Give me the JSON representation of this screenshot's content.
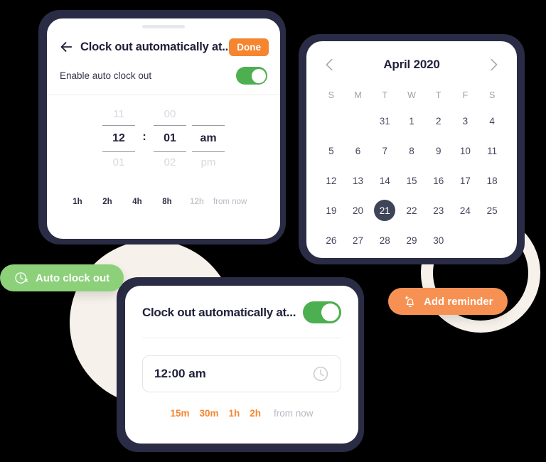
{
  "colors": {
    "background": "#000000",
    "device_frame": "#2a2b44",
    "card": "#ffffff",
    "accent_orange": "#f6852f",
    "toggle_green": "#4caf50",
    "pill_green": "#8cd07a",
    "pill_orange": "#f79153",
    "decor_cream": "#f6f1ea",
    "selected_day": "#3f4558",
    "muted_text": "#c9c9d0"
  },
  "time_picker_card": {
    "drag_handle": "drag-handle",
    "back_icon": "back-arrow-icon",
    "title": "Clock out automatically at...",
    "done_label": "Done",
    "enable_label": "Enable auto clock out",
    "toggle_state": "on",
    "wheel": {
      "hour": {
        "above": "11",
        "value": "12",
        "below": "01"
      },
      "separator": ":",
      "minute": {
        "above": "00",
        "value": "01",
        "below": "02"
      },
      "meridiem": {
        "above": "",
        "value": "am",
        "below": "pm"
      }
    },
    "quick_options": [
      {
        "label": "1h",
        "muted": false
      },
      {
        "label": "2h",
        "muted": false
      },
      {
        "label": "4h",
        "muted": false
      },
      {
        "label": "8h",
        "muted": false
      },
      {
        "label": "12h",
        "muted": true
      }
    ],
    "quick_suffix": "from now"
  },
  "calendar_card": {
    "prev_icon": "chevron-left-icon",
    "next_icon": "chevron-right-icon",
    "title": "April 2020",
    "day_labels": [
      "S",
      "M",
      "T",
      "W",
      "T",
      "F",
      "S"
    ],
    "selected_day": 21,
    "weeks": [
      [
        {
          "label": "",
          "type": "empty"
        },
        {
          "label": "",
          "type": "empty"
        },
        {
          "label": "31",
          "type": "other"
        },
        {
          "label": "1",
          "type": "current"
        },
        {
          "label": "2",
          "type": "current"
        },
        {
          "label": "3",
          "type": "current"
        },
        {
          "label": "4",
          "type": "current"
        }
      ],
      [
        {
          "label": "5",
          "type": "current"
        },
        {
          "label": "6",
          "type": "current"
        },
        {
          "label": "7",
          "type": "current"
        },
        {
          "label": "8",
          "type": "current"
        },
        {
          "label": "9",
          "type": "current"
        },
        {
          "label": "10",
          "type": "current"
        },
        {
          "label": "11",
          "type": "current"
        }
      ],
      [
        {
          "label": "12",
          "type": "current"
        },
        {
          "label": "13",
          "type": "current"
        },
        {
          "label": "14",
          "type": "current"
        },
        {
          "label": "15",
          "type": "current"
        },
        {
          "label": "16",
          "type": "current"
        },
        {
          "label": "17",
          "type": "current"
        },
        {
          "label": "18",
          "type": "current"
        }
      ],
      [
        {
          "label": "19",
          "type": "current"
        },
        {
          "label": "20",
          "type": "current"
        },
        {
          "label": "21",
          "type": "selected"
        },
        {
          "label": "22",
          "type": "current"
        },
        {
          "label": "23",
          "type": "current"
        },
        {
          "label": "24",
          "type": "current"
        },
        {
          "label": "25",
          "type": "current"
        }
      ],
      [
        {
          "label": "26",
          "type": "current"
        },
        {
          "label": "27",
          "type": "current"
        },
        {
          "label": "28",
          "type": "current"
        },
        {
          "label": "29",
          "type": "current"
        },
        {
          "label": "30",
          "type": "current"
        },
        {
          "label": "",
          "type": "empty"
        },
        {
          "label": "",
          "type": "empty"
        }
      ]
    ]
  },
  "compact_card": {
    "title": "Clock out automatically at...",
    "toggle_state": "on",
    "time_value": "12:00 am",
    "clock_icon": "clock-icon",
    "quick_options": [
      "15m",
      "30m",
      "1h",
      "2h"
    ],
    "quick_suffix": "from now"
  },
  "pills": {
    "green": {
      "icon": "auto-clock-out-icon",
      "label": "Auto clock out"
    },
    "orange": {
      "icon": "bell-reminder-icon",
      "label": "Add reminder"
    }
  }
}
